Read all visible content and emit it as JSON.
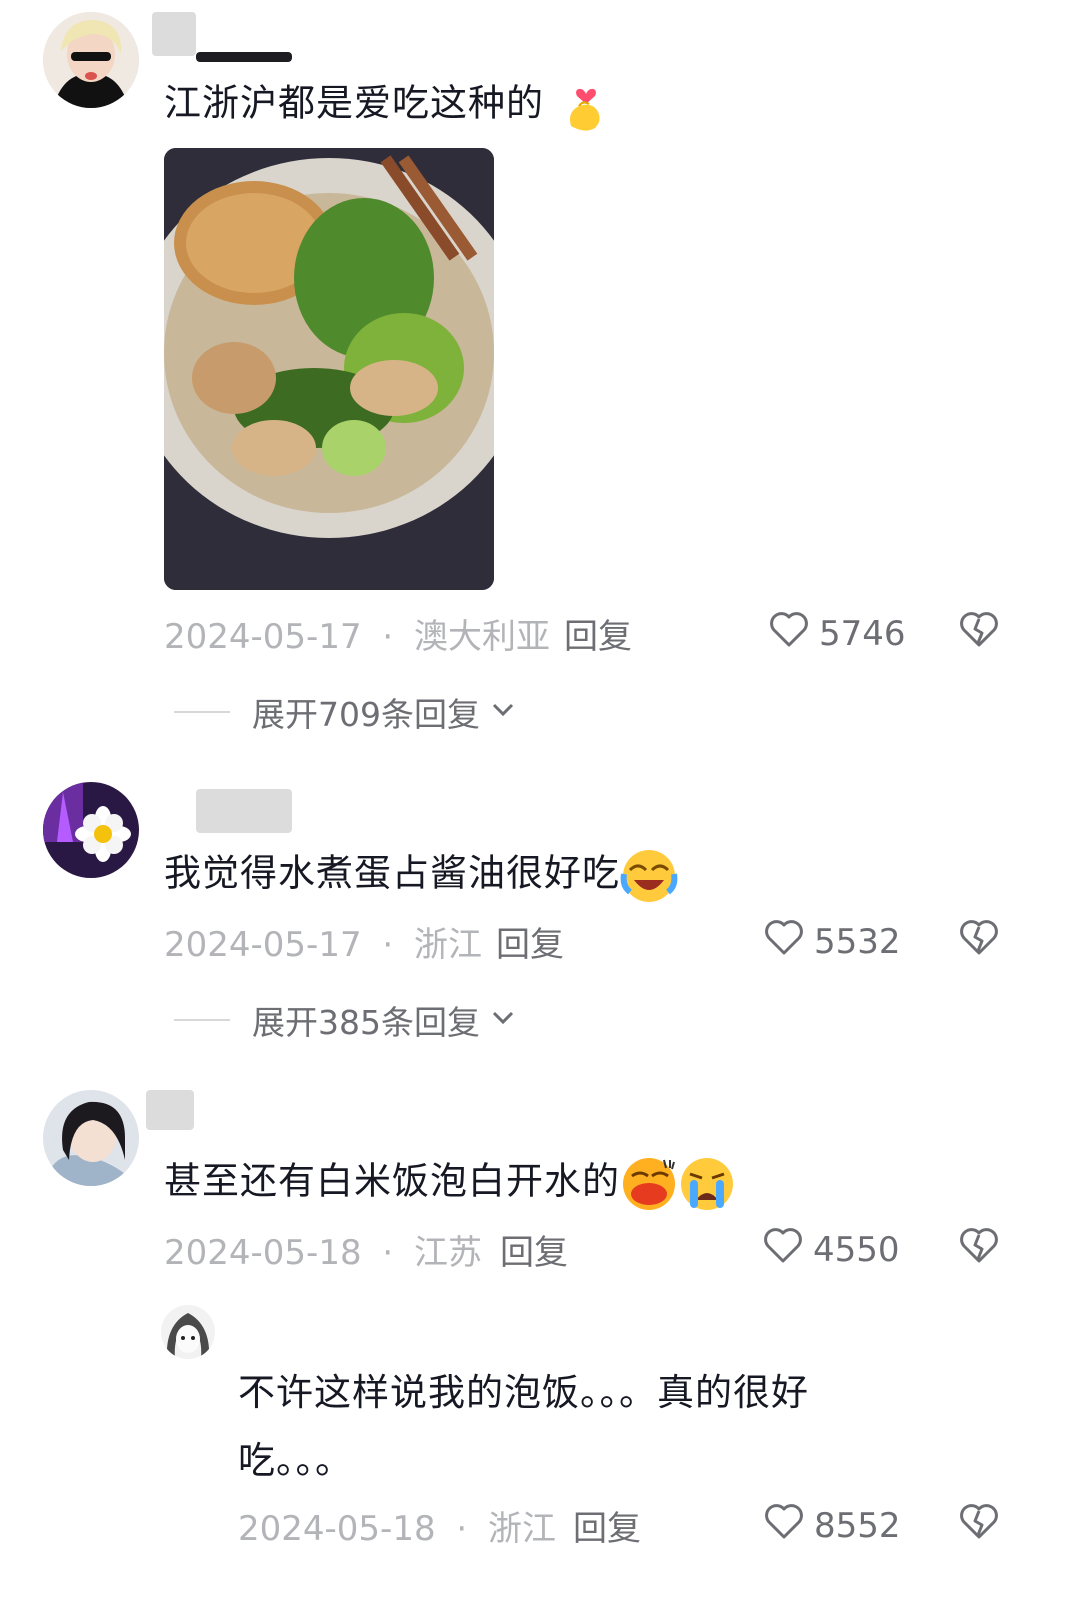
{
  "comments": [
    {
      "text": "江浙沪都是爱吃这种的",
      "emoji_icons": [
        "finger-heart-icon"
      ],
      "date": "2024-05-17",
      "location": "澳大利亚",
      "reply_label": "回复",
      "likes": "5746",
      "expand_label": "展开709条回复"
    },
    {
      "text": "我觉得水煮蛋占酱油很好吃",
      "emoji_icons": [
        "laugh-cry-face-icon"
      ],
      "date": "2024-05-17",
      "location": "浙江",
      "reply_label": "回复",
      "likes": "5532",
      "expand_label": "展开385条回复"
    },
    {
      "text": "甚至还有白米饭泡白开水的",
      "emoji_icons": [
        "grinning-face-icon",
        "crying-face-icon"
      ],
      "date": "2024-05-18",
      "location": "江苏",
      "reply_label": "回复",
      "likes": "4550"
    }
  ],
  "reply": {
    "text_line1": "不许这样说我的泡饭。。。真的很好",
    "text_line2": "吃。。。",
    "date": "2024-05-18",
    "location": "浙江",
    "reply_label": "回复",
    "likes": "8552"
  },
  "separator": "·",
  "colors": {
    "meta": "#b3b4b8",
    "action": "#6d6e73",
    "text": "#161823"
  }
}
